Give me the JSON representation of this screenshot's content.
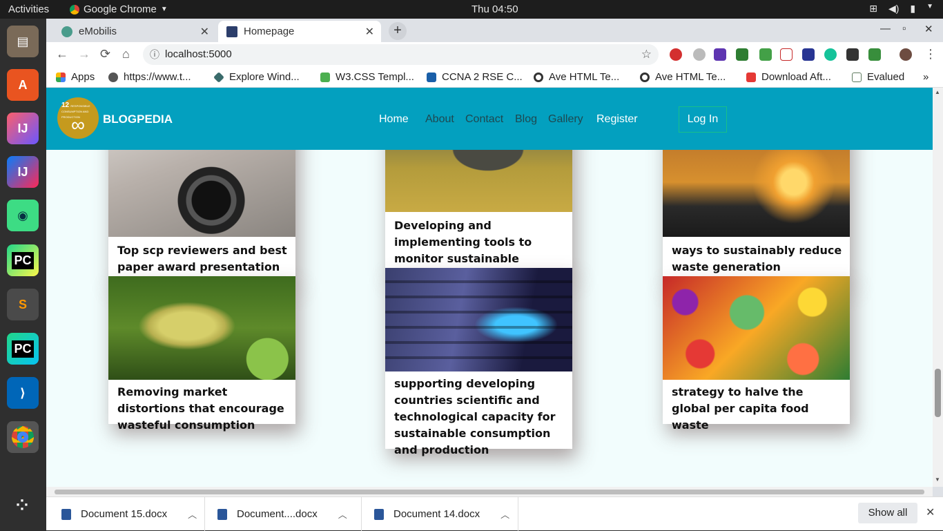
{
  "os": {
    "activities": "Activities",
    "app_menu": "Google Chrome",
    "clock": "Thu 04:50"
  },
  "dock": [
    "files-icon",
    "software-center-icon",
    "intellij-icon",
    "intellij-icon",
    "android-studio-icon",
    "pycharm-icon",
    "sublime-text-icon",
    "pycharm-icon",
    "vscode-icon",
    "chrome-icon",
    "app-grid-icon"
  ],
  "tabs": [
    {
      "title": "eMobilis",
      "close": "✕"
    },
    {
      "title": "Homepage",
      "close": "✕"
    }
  ],
  "newtab": "+",
  "window_controls": {
    "minimize": "—",
    "maximize": "▫",
    "close": "✕"
  },
  "toolbar": {
    "back": "←",
    "forward": "→",
    "reload": "⟳",
    "home": "⌂",
    "url": "localhost:5000",
    "info": "ⓘ",
    "star": "☆",
    "menu": "⋮"
  },
  "bookmarks": [
    {
      "label": "Apps",
      "color": "#e94235"
    },
    {
      "label": "https://www.t...",
      "color": "#555555"
    },
    {
      "label": "Explore Wind...",
      "color": "#3a6b6b"
    },
    {
      "label": "W3.CSS Templ...",
      "color": "#4caf50"
    },
    {
      "label": "CCNA 2 RSE C...",
      "color": "#1a5fa8"
    },
    {
      "label": "Ave HTML Te...",
      "color": "#333333"
    },
    {
      "label": "Ave HTML Te...",
      "color": "#333333"
    },
    {
      "label": "Download Aft...",
      "color": "#e53935"
    },
    {
      "label": "Evalued",
      "color": "#5d7a5d"
    }
  ],
  "bookmarks_more": "»",
  "site": {
    "brand": "BLOGPEDIA",
    "logo_number": "12",
    "logo_text": "RESPONSIBLE CONSUMPTION AND PRODUCTION",
    "logo_symbol": "∞",
    "nav": [
      "Home",
      "About",
      "Contact",
      "Blog",
      "Gallery",
      "Register"
    ],
    "login": "Log In"
  },
  "cards": [
    {
      "caption": "Top scp reviewers and best paper award presentation",
      "image": "camera-photo"
    },
    {
      "caption": "Developing and implementing tools to monitor sustainable tourism",
      "image": "rhino-photo"
    },
    {
      "caption": "ways to sustainably reduce waste generation",
      "image": "power-plant-photo"
    },
    {
      "caption": "Removing market distortions that encourage wasteful consumption",
      "image": "grapes-photo"
    },
    {
      "caption": "supporting developing countries scientific and technological capacity for sustainable consumption and production",
      "image": "server-cables-photo"
    },
    {
      "caption": "strategy to halve the global per capita food waste",
      "image": "fruits-photo"
    }
  ],
  "downloads": [
    {
      "name": "Document 15.docx"
    },
    {
      "name": "Document....docx"
    },
    {
      "name": "Document 14.docx"
    }
  ],
  "show_all": "Show all",
  "downloads_close": "✕"
}
